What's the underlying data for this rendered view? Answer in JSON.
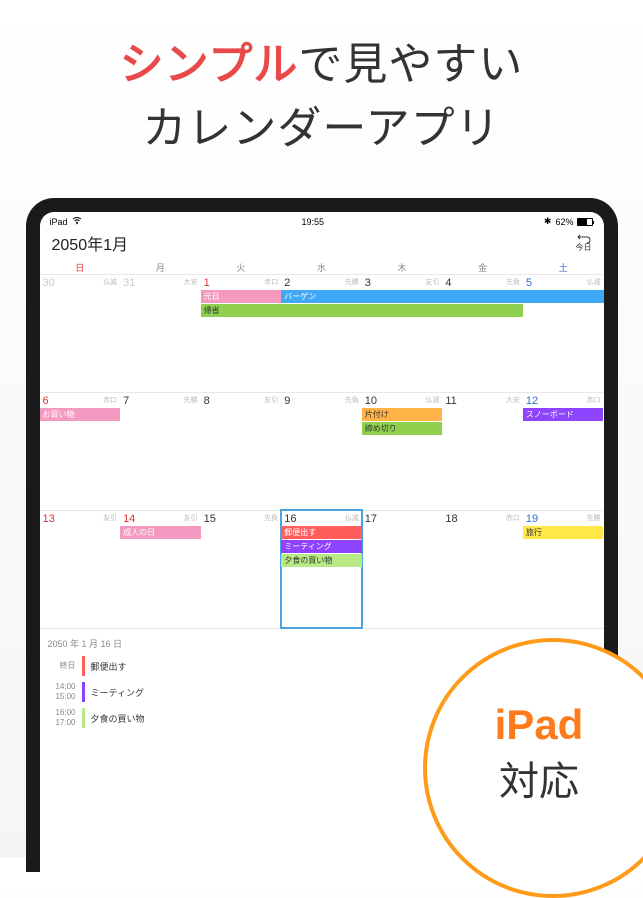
{
  "headline": {
    "accent": "シンプル",
    "rest1": "で見やすい",
    "line2": "カレンダーアプリ"
  },
  "status": {
    "device": "iPad",
    "time": "19:55",
    "battery_pct": "62%"
  },
  "header": {
    "month_title": "2050年1月",
    "today_label": "今日"
  },
  "weekdays": [
    "日",
    "月",
    "火",
    "水",
    "木",
    "金",
    "土"
  ],
  "weeks": [
    [
      {
        "d": "30",
        "muted": true,
        "rokuyo": "仏滅"
      },
      {
        "d": "31",
        "muted": true,
        "rokuyo": "大安"
      },
      {
        "d": "1",
        "rokuyo": "赤口",
        "holiday": true,
        "ev": [
          {
            "t": "元日",
            "c": "pink"
          },
          {
            "t": "帰省",
            "c": "green",
            "span": 4
          }
        ]
      },
      {
        "d": "2",
        "rokuyo": "先勝",
        "ev": [
          {
            "t": "バーゲン",
            "c": "blue",
            "span": 5
          }
        ]
      },
      {
        "d": "3",
        "rokuyo": "友引"
      },
      {
        "d": "4",
        "rokuyo": "先負"
      },
      {
        "d": "5",
        "sat": true,
        "rokuyo": "仏滅"
      }
    ],
    [
      {
        "d": "6",
        "sun": true,
        "rokuyo": "赤口",
        "ev": [
          {
            "t": "お買い物",
            "c": "pink"
          }
        ]
      },
      {
        "d": "7",
        "rokuyo": "先勝"
      },
      {
        "d": "8",
        "rokuyo": "友引"
      },
      {
        "d": "9",
        "rokuyo": "先負"
      },
      {
        "d": "10",
        "rokuyo": "仏滅",
        "ev": [
          {
            "t": "片付け",
            "c": "orange"
          },
          {
            "t": "締め切り",
            "c": "green"
          }
        ]
      },
      {
        "d": "11",
        "rokuyo": "大安"
      },
      {
        "d": "12",
        "sat": true,
        "rokuyo": "赤口",
        "ev": [
          {
            "t": "スノーボード",
            "c": "purple"
          }
        ]
      }
    ],
    [
      {
        "d": "13",
        "sun": true,
        "rokuyo": "友引"
      },
      {
        "d": "14",
        "rokuyo": "友引",
        "holiday": true,
        "ev": [
          {
            "t": "成人の日",
            "c": "pink"
          }
        ]
      },
      {
        "d": "15",
        "rokuyo": "先負"
      },
      {
        "d": "16",
        "rokuyo": "仏滅",
        "selected": true,
        "ev": [
          {
            "t": "郵便出す",
            "c": "red"
          },
          {
            "t": "ミーティング",
            "c": "purple"
          },
          {
            "t": "夕食の買い物",
            "c": "lime"
          }
        ]
      },
      {
        "d": "17",
        "rokuyo": ""
      },
      {
        "d": "18",
        "rokuyo": "赤口"
      },
      {
        "d": "19",
        "sat": true,
        "rokuyo": "先勝",
        "ev": [
          {
            "t": "旅行",
            "c": "yellow"
          }
        ]
      }
    ]
  ],
  "agenda": {
    "date": "2050 年 1 月 16 日",
    "items": [
      {
        "time1": "終日",
        "time2": "",
        "color": "red",
        "title": "郵便出す"
      },
      {
        "time1": "14:00",
        "time2": "15:00",
        "color": "purple",
        "title": "ミーティング"
      },
      {
        "time1": "16:00",
        "time2": "17:00",
        "color": "lime",
        "title": "夕食の買い物"
      }
    ]
  },
  "badge": {
    "l1": "iPad",
    "l2": "対応"
  }
}
